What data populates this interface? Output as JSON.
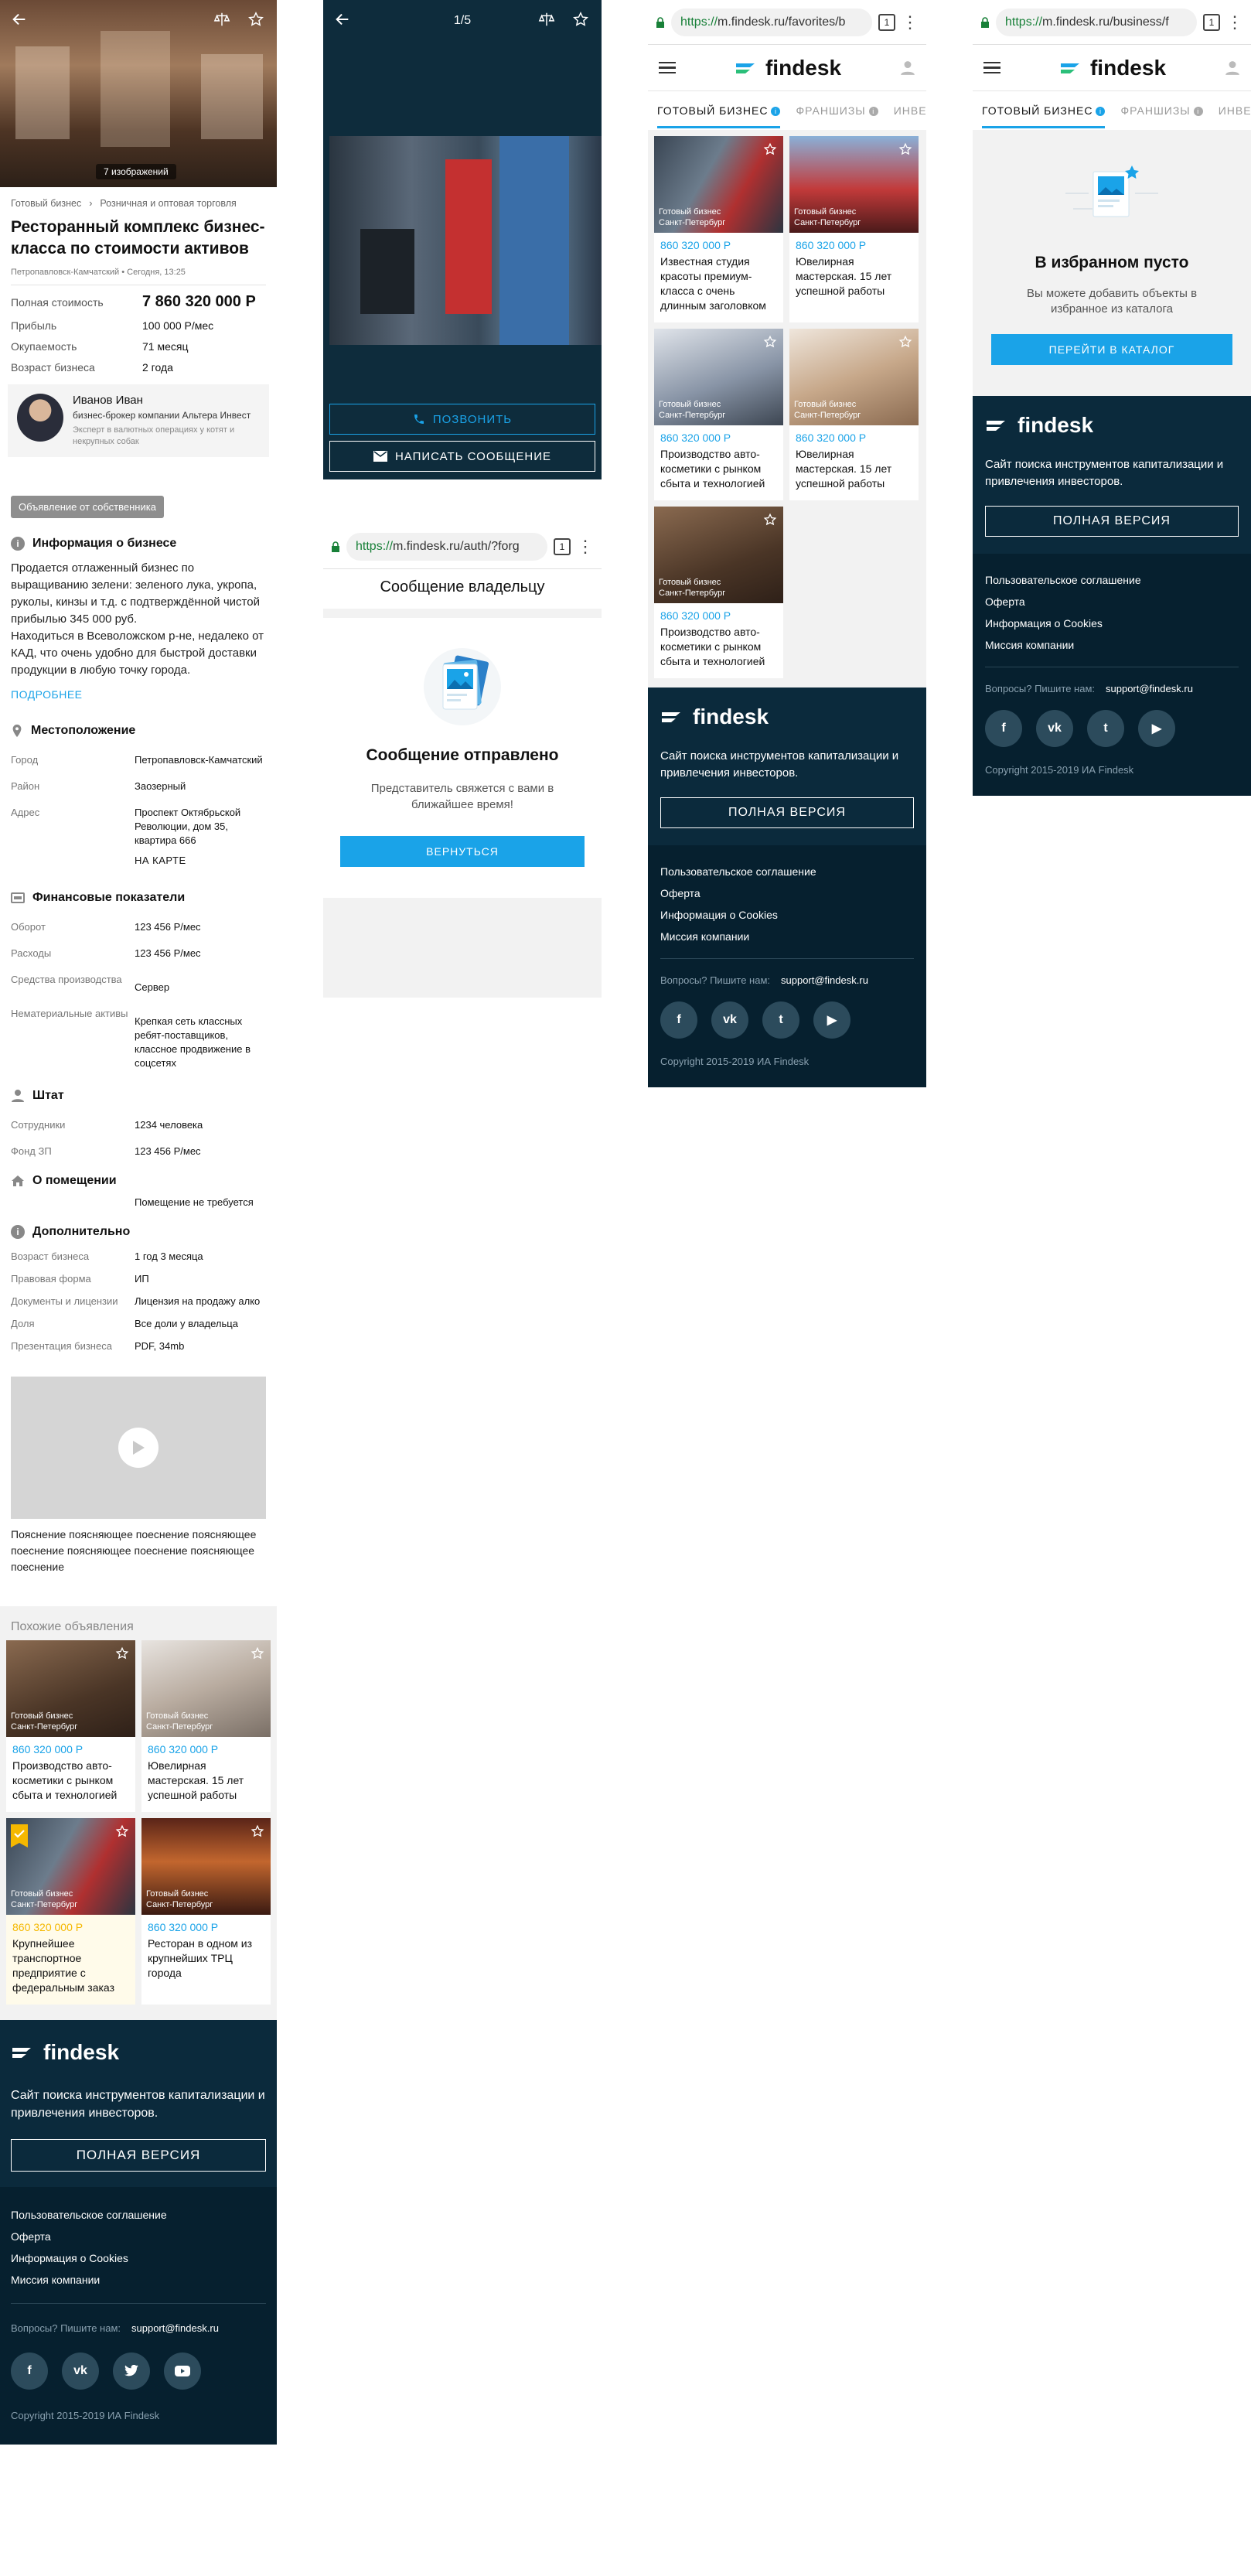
{
  "col1": {
    "hero": {
      "badge": "7 изображений"
    },
    "breadcrumbs": [
      "Готовый бизнес",
      "Розничная и оптовая торговля"
    ],
    "title": "Ресторанный комплекс бизнес-класса по стоимости активов",
    "meta": "Петропавловск-Камчатский • Сегодня, 13:25",
    "stats": [
      {
        "k": "Полная стоимость",
        "v": "7 860 320 000 Р"
      },
      {
        "k": "Прибыль",
        "v": "100 000 Р/мес"
      },
      {
        "k": "Окупаемость",
        "v": "71 месяц"
      },
      {
        "k": "Возраст бизнеса",
        "v": "2 года"
      }
    ],
    "broker": {
      "name": "Иванов Иван",
      "role": "бизнес-брокер компании Альтера Инвест",
      "desc": "Эксперт в валютных операциях у котят и некрупных собак"
    },
    "owner_button": "Объявление от собственника",
    "info": {
      "title": "Информация о бизнесе",
      "text": "Продается отлаженный бизнес по выращиванию зелени: зеленого лука, укропа, руколы, кинзы и т.д. с подтверждённой чистой прибылью 345 000 руб.\nНаходиться в Всеволожском р-не, недалеко от КАД, что очень удобно для быстрой доставки продукции в любую точку города.",
      "more": "ПОДРОБНЕЕ"
    },
    "location": {
      "title": "Местоположение",
      "rows": [
        {
          "k": "Город",
          "v": "Петропавловск-Камчатский"
        },
        {
          "k": "Район",
          "v": "Заозерный"
        },
        {
          "k": "Адрес",
          "v": "Проспект Октябрьской Революции, дом 35, квартира 666"
        }
      ],
      "map": "НА КАРТЕ"
    },
    "finance": {
      "title": "Финансовые показатели",
      "rows": [
        {
          "k": "Оборот",
          "v": "123 456 Р/мес"
        },
        {
          "k": "Расходы",
          "v": "123 456 Р/мес"
        },
        {
          "k": "Средства производства",
          "v": "Сервер"
        },
        {
          "k": "Нематериальные активы",
          "v": "Крепкая сеть классных ребят-поставщиков, классное продвижение в соцсетях"
        }
      ]
    },
    "staff": {
      "title": "Штат",
      "rows": [
        {
          "k": "Сотрудники",
          "v": "1234 человека"
        },
        {
          "k": "Фонд ЗП",
          "v": "123 456 Р/мес"
        }
      ]
    },
    "premises": {
      "title": "О помещении",
      "v": "Помещение не требуется"
    },
    "extra": {
      "title": "Дополнительно",
      "rows": [
        {
          "k": "Возраст бизнеса",
          "v": "1 год 3 месяца"
        },
        {
          "k": "Правовая форма",
          "v": "ИП"
        },
        {
          "k": "Документы и лицензии",
          "v": "Лицензия на продажу алко"
        },
        {
          "k": "Доля",
          "v": "Все доли у владельца"
        },
        {
          "k": "Презентация бизнеса",
          "v": "PDF, 34mb"
        }
      ]
    },
    "video_caption": "Пояснение поясняющее поеснение поясняющее поеснение поясняющее поеснение поясняющее поеснение",
    "similar": {
      "title": "Похожие объявления",
      "cards": [
        {
          "label1": "Готовый бизнес",
          "label2": "Санкт-Петербург",
          "price": "860 320 000 Р",
          "text": "Производство авто-косметики с рынком сбыта и технологией"
        },
        {
          "label1": "Готовый бизнес",
          "label2": "Санкт-Петербург",
          "price": "860 320 000 Р",
          "text": "Ювелирная мастерская. 15 лет успешной работы"
        },
        {
          "label1": "Готовый бизнес",
          "label2": "Санкт-Петербург",
          "price": "860 320 000 Р",
          "text": "Крупнейшее транспортное предприятие с федеральным заказ"
        },
        {
          "label1": "Готовый бизнес",
          "label2": "Санкт-Петербург",
          "price": "860 320 000 Р",
          "text": "Ресторан в одном из крупнейших ТРЦ города"
        }
      ]
    }
  },
  "footer": {
    "logo": "findesk",
    "tagline": "Сайт поиска инструментов капитализации и привлечения инвесторов.",
    "full_version": "ПОЛНАЯ ВЕРСИЯ",
    "links": [
      "Пользовательское соглашение",
      "Оферта",
      "Информация о Cookies",
      "Миссия компании"
    ],
    "questions": "Вопросы? Пишите нам:",
    "email": "support@findesk.ru",
    "socials": [
      "f",
      "vk",
      "tw",
      "yt"
    ],
    "copyright": "Copyright 2015-2019 ИА Findesk"
  },
  "col2": {
    "counter": "1/5",
    "call": "ПОЗВОНИТЬ",
    "message": "НАПИСАТЬ СООБЩЕНИЕ",
    "url_green": "https://",
    "url_rest": "m.findesk.ru/auth/?forg",
    "tabs_count": "1",
    "screen_title": "Сообщение владельцу",
    "sent_title": "Сообщение отправлено",
    "sent_text": "Представитель свяжется с вами в ближайшее время!",
    "back_button": "ВЕРНУТЬСЯ"
  },
  "col3": {
    "url_green": "https://",
    "url_rest": "m.findesk.ru/favorites/b",
    "tabs": [
      "ГОТОВЫЙ БИЗНЕС",
      "ФРАНШИЗЫ",
      "ИНВЕ"
    ],
    "cards": [
      {
        "label1": "Готовый бизнес",
        "label2": "Санкт-Петербург",
        "price": "860 320 000 Р",
        "text": "Известная студия красоты премиум-класса с очень длинным заголовком"
      },
      {
        "label1": "Готовый бизнес",
        "label2": "Санкт-Петербург",
        "price": "860 320 000 Р",
        "text": "Ювелирная мастерская. 15 лет успешной работы"
      },
      {
        "label1": "Готовый бизнес",
        "label2": "Санкт-Петербург",
        "price": "860 320 000 Р",
        "text": "Производство авто-косметики с рынком сбыта и технологией"
      },
      {
        "label1": "Готовый бизнес",
        "label2": "Санкт-Петербург",
        "price": "860 320 000 Р",
        "text": "Ювелирная мастерская. 15 лет успешной работы"
      },
      {
        "label1": "Готовый бизнес",
        "label2": "Санкт-Петербург",
        "price": "860 320 000 Р",
        "text": "Производство авто-косметики с рынком сбыта и технологией"
      }
    ]
  },
  "col4": {
    "url_green": "https://",
    "url_rest": "m.findesk.ru/business/f",
    "tabs": [
      "ГОТОВЫЙ БИЗНЕС",
      "ФРАНШИЗЫ",
      "ИНВЕ"
    ],
    "empty_title": "В избранном пусто",
    "empty_text": "Вы можете добавить объекты в избранное из каталога",
    "catalog_button": "ПЕРЕЙТИ В КАТАЛОГ"
  },
  "colors": {
    "accent": "#1aa3e8",
    "footer": "#0b2a3c",
    "dark": "#0e2c3c",
    "gold": "#f5b800"
  }
}
